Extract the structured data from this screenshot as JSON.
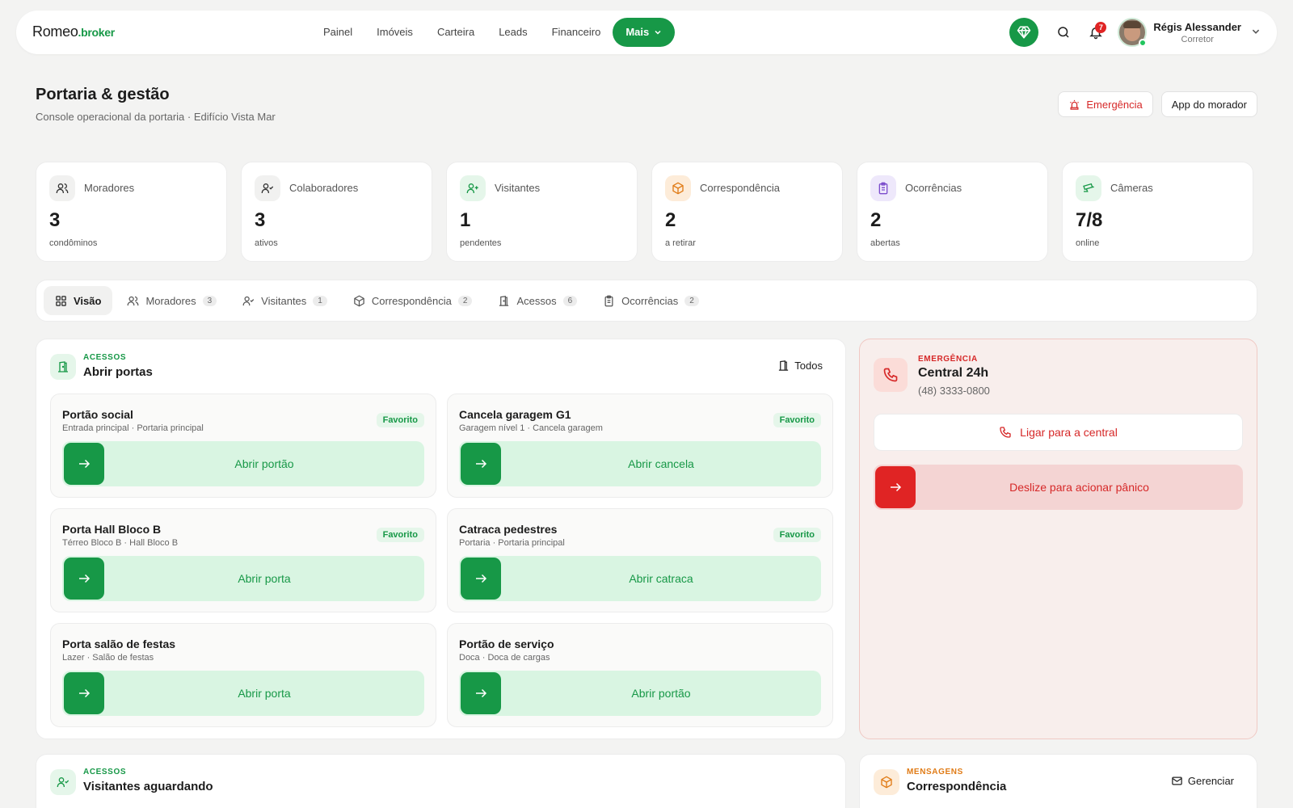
{
  "brand": {
    "name": "Romeo",
    "suffix": ".broker"
  },
  "nav": {
    "items": [
      {
        "label": "Painel"
      },
      {
        "label": "Imóveis"
      },
      {
        "label": "Carteira"
      },
      {
        "label": "Leads"
      },
      {
        "label": "Financeiro"
      }
    ],
    "more_label": "Mais"
  },
  "topbar": {
    "notifications_count": "7",
    "user_name": "Régis Alessander",
    "user_role": "Corretor"
  },
  "header": {
    "title": "Portaria & gestão",
    "subtitle": "Console operacional da portaria · Edifício Vista Mar",
    "emergency_label": "Emergência",
    "app_label": "App do morador"
  },
  "stats": [
    {
      "label": "Moradores",
      "value": "3",
      "foot": "condôminos",
      "icon": "users-icon",
      "bg": "#f1f1f0",
      "color": "#333333"
    },
    {
      "label": "Colaboradores",
      "value": "3",
      "foot": "ativos",
      "icon": "user-check-icon",
      "bg": "#f1f1f0",
      "color": "#333333"
    },
    {
      "label": "Visitantes",
      "value": "1",
      "foot": "pendentes",
      "icon": "user-plus-icon",
      "bg": "#e5f6ea",
      "color": "#179847"
    },
    {
      "label": "Correspondência",
      "value": "2",
      "foot": "a retirar",
      "icon": "package-icon",
      "bg": "#fdecd9",
      "color": "#e07b16"
    },
    {
      "label": "Ocorrências",
      "value": "2",
      "foot": "abertas",
      "icon": "clipboard-icon",
      "bg": "#eee8fb",
      "color": "#7c4dcc"
    },
    {
      "label": "Câmeras",
      "value": "7/8",
      "foot": "online",
      "icon": "cctv-icon",
      "bg": "#e5f6ea",
      "color": "#179847"
    }
  ],
  "tabs": [
    {
      "label": "Visão",
      "count": null
    },
    {
      "label": "Moradores",
      "count": "3"
    },
    {
      "label": "Visitantes",
      "count": "1"
    },
    {
      "label": "Correspondência",
      "count": "2"
    },
    {
      "label": "Acessos",
      "count": "6"
    },
    {
      "label": "Ocorrências",
      "count": "2"
    }
  ],
  "access": {
    "eyebrow": "ACESSOS",
    "title": "Abrir portas",
    "all_label": "Todos",
    "doors": [
      {
        "name": "Portão social",
        "location": "Entrada principal · Portaria principal",
        "favorite": "Favorito",
        "action": "Abrir portão"
      },
      {
        "name": "Cancela garagem G1",
        "location": "Garagem nível 1 · Cancela garagem",
        "favorite": "Favorito",
        "action": "Abrir cancela"
      },
      {
        "name": "Porta Hall Bloco B",
        "location": "Térreo Bloco B · Hall Bloco B",
        "favorite": "Favorito",
        "action": "Abrir porta"
      },
      {
        "name": "Catraca pedestres",
        "location": "Portaria · Portaria principal",
        "favorite": "Favorito",
        "action": "Abrir catraca"
      },
      {
        "name": "Porta salão de festas",
        "location": "Lazer · Salão de festas",
        "favorite": null,
        "action": "Abrir porta"
      },
      {
        "name": "Portão de serviço",
        "location": "Doca · Doca de cargas",
        "favorite": null,
        "action": "Abrir portão"
      }
    ]
  },
  "emergency": {
    "eyebrow": "EMERGÊNCIA",
    "title": "Central 24h",
    "phone": "(48) 3333-0800",
    "call_label": "Ligar para a central",
    "panic_label": "Deslize para acionar pânico"
  },
  "visitors": {
    "eyebrow": "ACESSOS",
    "title": "Visitantes aguardando"
  },
  "mail": {
    "eyebrow": "MENSAGENS",
    "title": "Correspondência",
    "manage_label": "Gerenciar"
  },
  "colors": {
    "brand_green": "#179847",
    "danger": "#d62828",
    "mail_orange": "#e07b16"
  }
}
